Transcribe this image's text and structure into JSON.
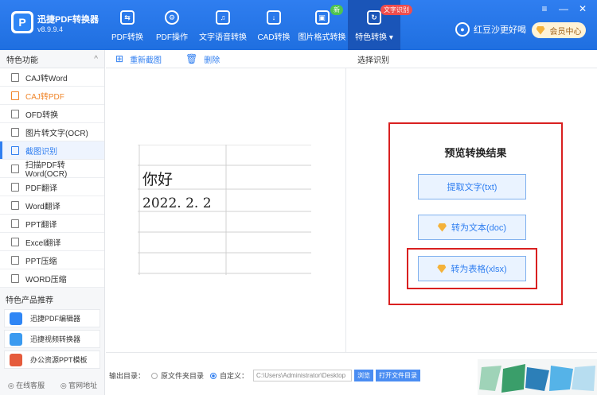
{
  "app": {
    "name": "迅捷PDF转换器",
    "version": "v8.9.9.4",
    "logo_letter": "P"
  },
  "nav": [
    {
      "label": "PDF转换",
      "icon": "pdf-convert-icon",
      "glyph": "⇆",
      "active": false
    },
    {
      "label": "PDF操作",
      "icon": "pdf-operate-icon",
      "glyph": "⚙",
      "active": false
    },
    {
      "label": "文字语音转换",
      "icon": "audio-icon",
      "glyph": "♫",
      "active": false
    },
    {
      "label": "CAD转换",
      "icon": "cad-icon",
      "glyph": "↓",
      "active": false
    },
    {
      "label": "图片格式转换",
      "icon": "image-icon",
      "glyph": "▣",
      "badge": "新",
      "active": false
    },
    {
      "label": "特色转换",
      "icon": "feature-icon",
      "glyph": "↻",
      "badge": "文字识别",
      "active": true
    }
  ],
  "user": {
    "name": "红豆沙更好喝",
    "vip": "会员中心"
  },
  "window": {
    "menu": "≡",
    "minimize": "—",
    "close": "✕"
  },
  "sidebar": {
    "header": "特色功能",
    "collapse": "^",
    "items": [
      {
        "label": "CAJ转Word",
        "style": "normal"
      },
      {
        "label": "CAJ转PDF",
        "style": "orange"
      },
      {
        "label": "OFD转换",
        "style": "normal"
      },
      {
        "label": "图片转文字(OCR)",
        "style": "normal"
      },
      {
        "label": "截图识别",
        "style": "active"
      },
      {
        "label": "扫描PDF转Word(OCR)",
        "style": "normal"
      },
      {
        "label": "PDF翻译",
        "style": "normal"
      },
      {
        "label": "Word翻译",
        "style": "normal"
      },
      {
        "label": "PPT翻译",
        "style": "normal"
      },
      {
        "label": "Excel翻译",
        "style": "normal"
      },
      {
        "label": "PPT压缩",
        "style": "normal"
      },
      {
        "label": "WORD压缩",
        "style": "normal"
      }
    ],
    "promo_header": "特色产品推荐",
    "promos": [
      {
        "label": "迅捷PDF编辑器",
        "color": "#2f86f5"
      },
      {
        "label": "迅捷视频转换器",
        "color": "#3a9af0"
      },
      {
        "label": "办公资源PPT模板",
        "color": "#e55b3c"
      }
    ],
    "footer": {
      "service": "在线客服",
      "website": "官网地址"
    }
  },
  "toolbar": {
    "recapture": "重新截图",
    "delete": "删除"
  },
  "preview": {
    "cell1": "你好",
    "cell2": "2022. 2. 2"
  },
  "right": {
    "header": "选择识别",
    "title": "预览转换结果",
    "btn_txt": "提取文字(txt)",
    "btn_doc": "转为文本(doc)",
    "btn_xlsx": "转为表格(xlsx)"
  },
  "bottom": {
    "output_label": "输出目录：",
    "opt_source": "原文件夹目录",
    "opt_custom": "自定义：",
    "path": "C:\\Users\\Administrator\\Desktop",
    "browse": "浏览",
    "open_dir": "打开文件目录"
  },
  "colors": {
    "primary": "#2f7ef0",
    "highlight": "#d92020",
    "orange": "#f0852a"
  }
}
